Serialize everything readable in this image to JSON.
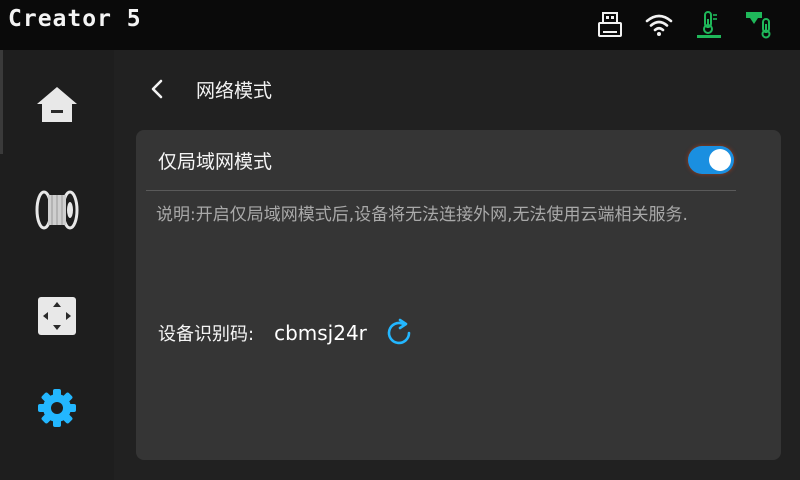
{
  "header": {
    "title": "Creator 5",
    "status_icons": [
      "usb-icon",
      "wifi-icon",
      "bed-temperature-icon",
      "nozzle-temperature-icon"
    ]
  },
  "sidebar": {
    "items": [
      {
        "name": "home",
        "icon": "home-icon"
      },
      {
        "name": "filament",
        "icon": "filament-spool-icon"
      },
      {
        "name": "move-axis",
        "icon": "move-axis-icon"
      },
      {
        "name": "settings",
        "icon": "gear-icon",
        "active": true
      }
    ]
  },
  "page": {
    "title": "网络模式"
  },
  "lan_mode": {
    "label": "仅局域网模式",
    "enabled": true,
    "description": "说明:开启仅局域网模式后,设备将无法连接外网,无法使用云端相关服务."
  },
  "device_id": {
    "label": "设备识别码:",
    "value": "cbmsj24r"
  },
  "colors": {
    "accent": "#1a8fe0",
    "active_icon": "#23b7ff",
    "status_green": "#1fb85a"
  }
}
